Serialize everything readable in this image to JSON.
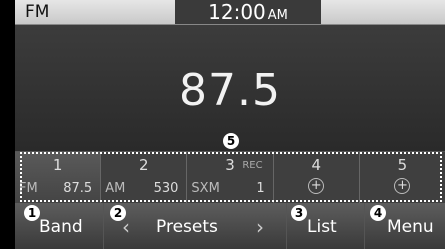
{
  "status": {
    "mode": "FM",
    "time": "12:00",
    "ampm": "AM"
  },
  "frequency": "87.5",
  "presets": [
    {
      "number": "1",
      "band": "FM",
      "freq": "87.5",
      "rec": "",
      "empty": false
    },
    {
      "number": "2",
      "band": "AM",
      "freq": "530",
      "rec": "",
      "empty": false
    },
    {
      "number": "3",
      "band": "SXM",
      "freq": "1",
      "rec": "REC",
      "empty": false
    },
    {
      "number": "4",
      "band": "",
      "freq": "",
      "rec": "",
      "empty": true
    },
    {
      "number": "5",
      "band": "",
      "freq": "",
      "rec": "",
      "empty": true
    }
  ],
  "buttons": {
    "band": "Band",
    "presets": "Presets",
    "list": "List",
    "menu": "Menu"
  },
  "callouts": [
    "1",
    "2",
    "3",
    "4",
    "5"
  ],
  "icons": {
    "prev": "chevron-left-icon",
    "next": "chevron-right-icon",
    "add": "plus-circle-icon"
  }
}
